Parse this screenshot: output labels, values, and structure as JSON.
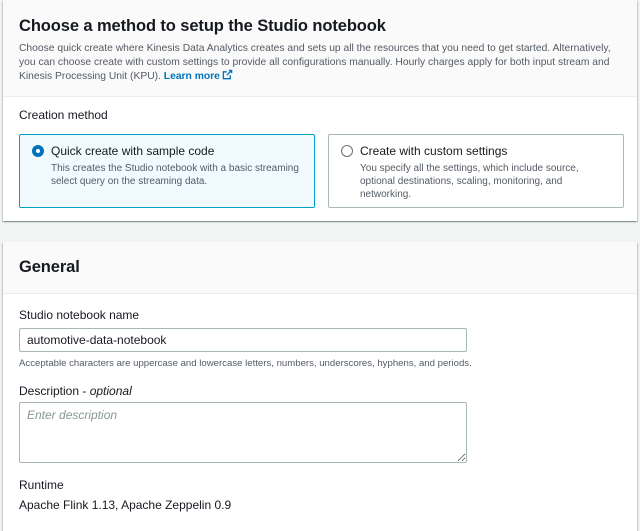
{
  "method_panel": {
    "title": "Choose a method to setup the Studio notebook",
    "description": "Choose quick create where Kinesis Data Analytics creates and sets up all the resources that you need to get started. Alternatively, you can choose create with custom settings to provide all configurations manually. Hourly charges apply for both input stream and Kinesis Processing Unit (KPU).",
    "learn_more": "Learn more",
    "creation_label": "Creation method",
    "options": [
      {
        "title": "Quick create with sample code",
        "description": "This creates the Studio notebook with a basic streaming select query on the streaming data.",
        "selected": true
      },
      {
        "title": "Create with custom settings",
        "description": "You specify all the settings, which include source, optional destinations, scaling, monitoring, and networking.",
        "selected": false
      }
    ]
  },
  "general_panel": {
    "title": "General",
    "name_label": "Studio notebook name",
    "name_value": "automotive-data-notebook",
    "name_hint": "Acceptable characters are uppercase and lowercase letters, numbers, underscores, hyphens, and periods.",
    "description_label": "Description",
    "description_optional": "optional",
    "description_placeholder": "Enter description",
    "description_value": "",
    "runtime_label": "Runtime",
    "runtime_value": "Apache Flink 1.13, Apache Zeppelin 0.9"
  },
  "colors": {
    "accent": "#0073bb",
    "selected_border": "#00a1c9",
    "selected_bg": "#f1faff"
  },
  "icons": {
    "learn_more": "external-link-icon"
  }
}
